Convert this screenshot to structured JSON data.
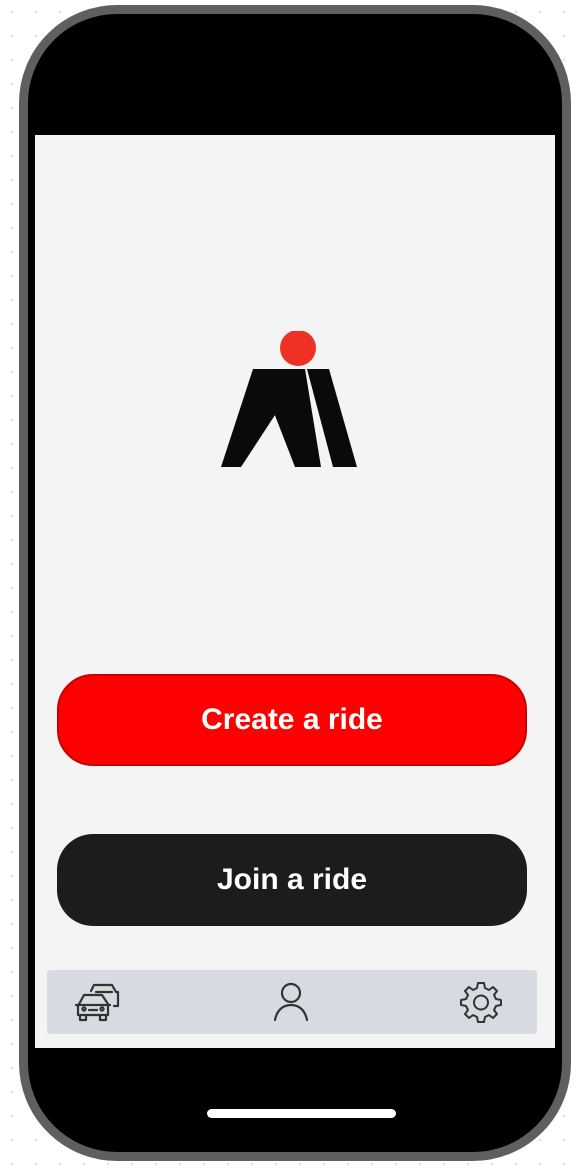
{
  "buttons": {
    "create_label": "Create a ride",
    "join_label": "Join a ride"
  },
  "tabbar": {
    "items": [
      {
        "icon": "cars-icon"
      },
      {
        "icon": "user-icon"
      },
      {
        "icon": "gear-icon"
      }
    ]
  },
  "colors": {
    "accent": "#ff0000",
    "dark_button": "#1c1c1c",
    "logo_dot": "#ee3124",
    "tabbar_bg": "#d5dbe0",
    "screen_bg": "#f4f4f4"
  }
}
